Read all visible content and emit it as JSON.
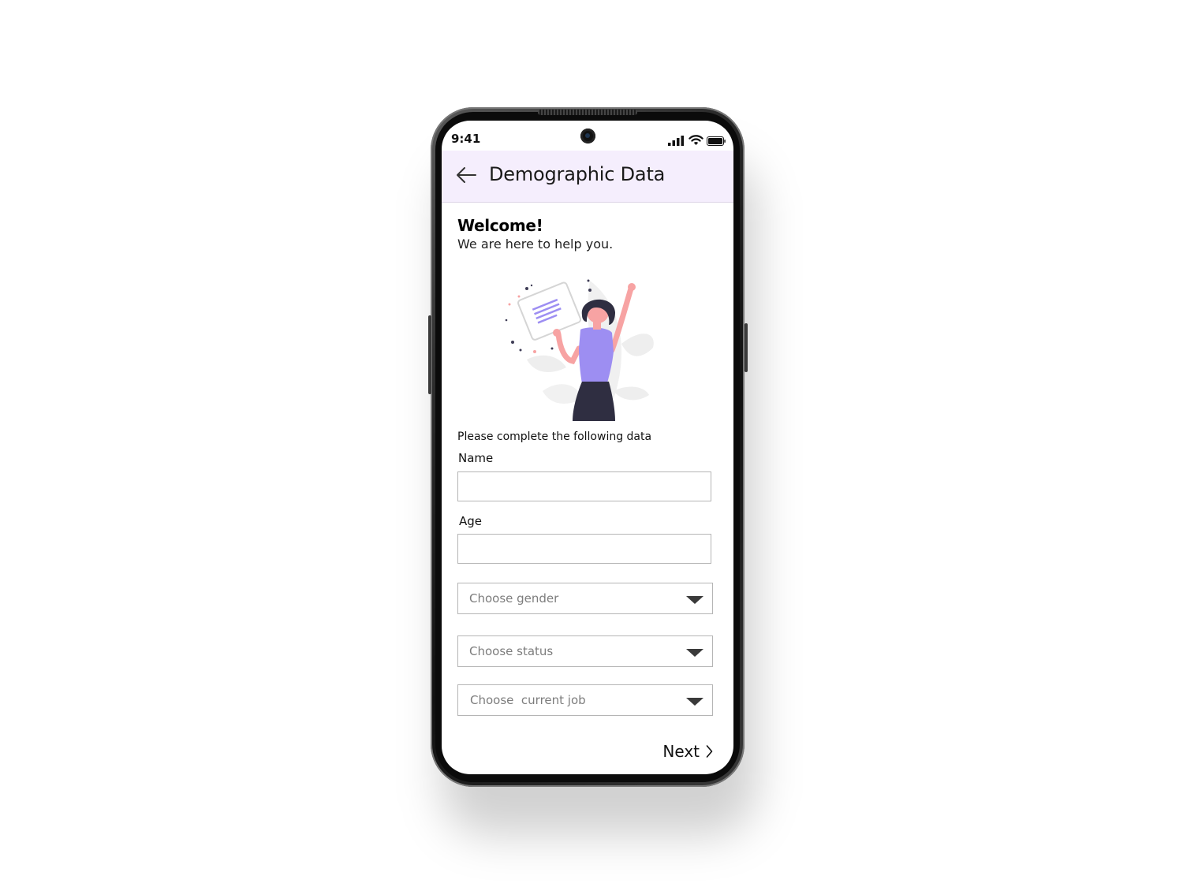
{
  "status_bar": {
    "time": "9:41"
  },
  "app_bar": {
    "title": "Demographic Data"
  },
  "welcome": {
    "heading": "Welcome!",
    "subtitle": "We are here to help you."
  },
  "form": {
    "instruction": "Please complete the following data",
    "name_label": "Name",
    "name_value": "",
    "age_label": "Age",
    "age_value": "",
    "gender_select": "Choose gender",
    "status_select": "Choose status",
    "job_select": "Choose  current job"
  },
  "actions": {
    "next_label": "Next"
  },
  "colors": {
    "app_bar_bg": "#f5eefd",
    "illustration_accent": "#9d8ef2",
    "illustration_skin": "#f7a3a3",
    "text": "#111111",
    "placeholder": "#7d7d7d"
  },
  "icons": {
    "back": "arrow-left-icon",
    "dropdown": "chevron-down-icon",
    "next": "chevron-right-icon",
    "signal": "signal-icon",
    "wifi": "wifi-icon",
    "battery": "battery-icon"
  }
}
